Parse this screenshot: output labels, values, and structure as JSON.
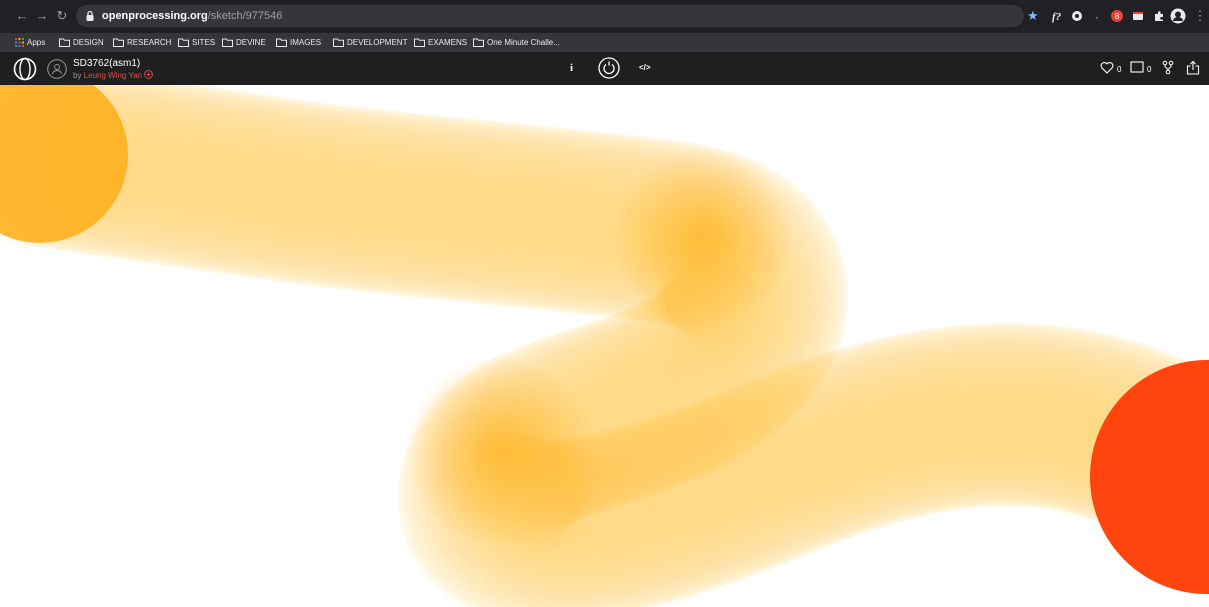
{
  "browser": {
    "url_host": "openprocessing.org",
    "url_path": "/sketch/977546",
    "badge_count": "8"
  },
  "bookmarks": [
    {
      "label": "Apps"
    },
    {
      "label": "DESIGN"
    },
    {
      "label": "RESEARCH"
    },
    {
      "label": "SITES"
    },
    {
      "label": "DEVINE"
    },
    {
      "label": "IMAGES"
    },
    {
      "label": "DEVELOPMENT"
    },
    {
      "label": "EXAMENS"
    },
    {
      "label": "One Minute Challe..."
    }
  ],
  "sketch": {
    "title": "SD3762(asm1)",
    "by_prefix": "by",
    "author": "Leung Wing Yan",
    "info_label": "i",
    "code_label": "</>",
    "likes": "0",
    "comments": "0"
  },
  "colors": {
    "chrome_bg": "#202124",
    "bookmarks_bg": "#35363a",
    "appbar_bg": "#1f1f1f",
    "author_red": "#e2504c",
    "trail_yellow": "#ffc846",
    "end_circle": "#ff440d"
  }
}
